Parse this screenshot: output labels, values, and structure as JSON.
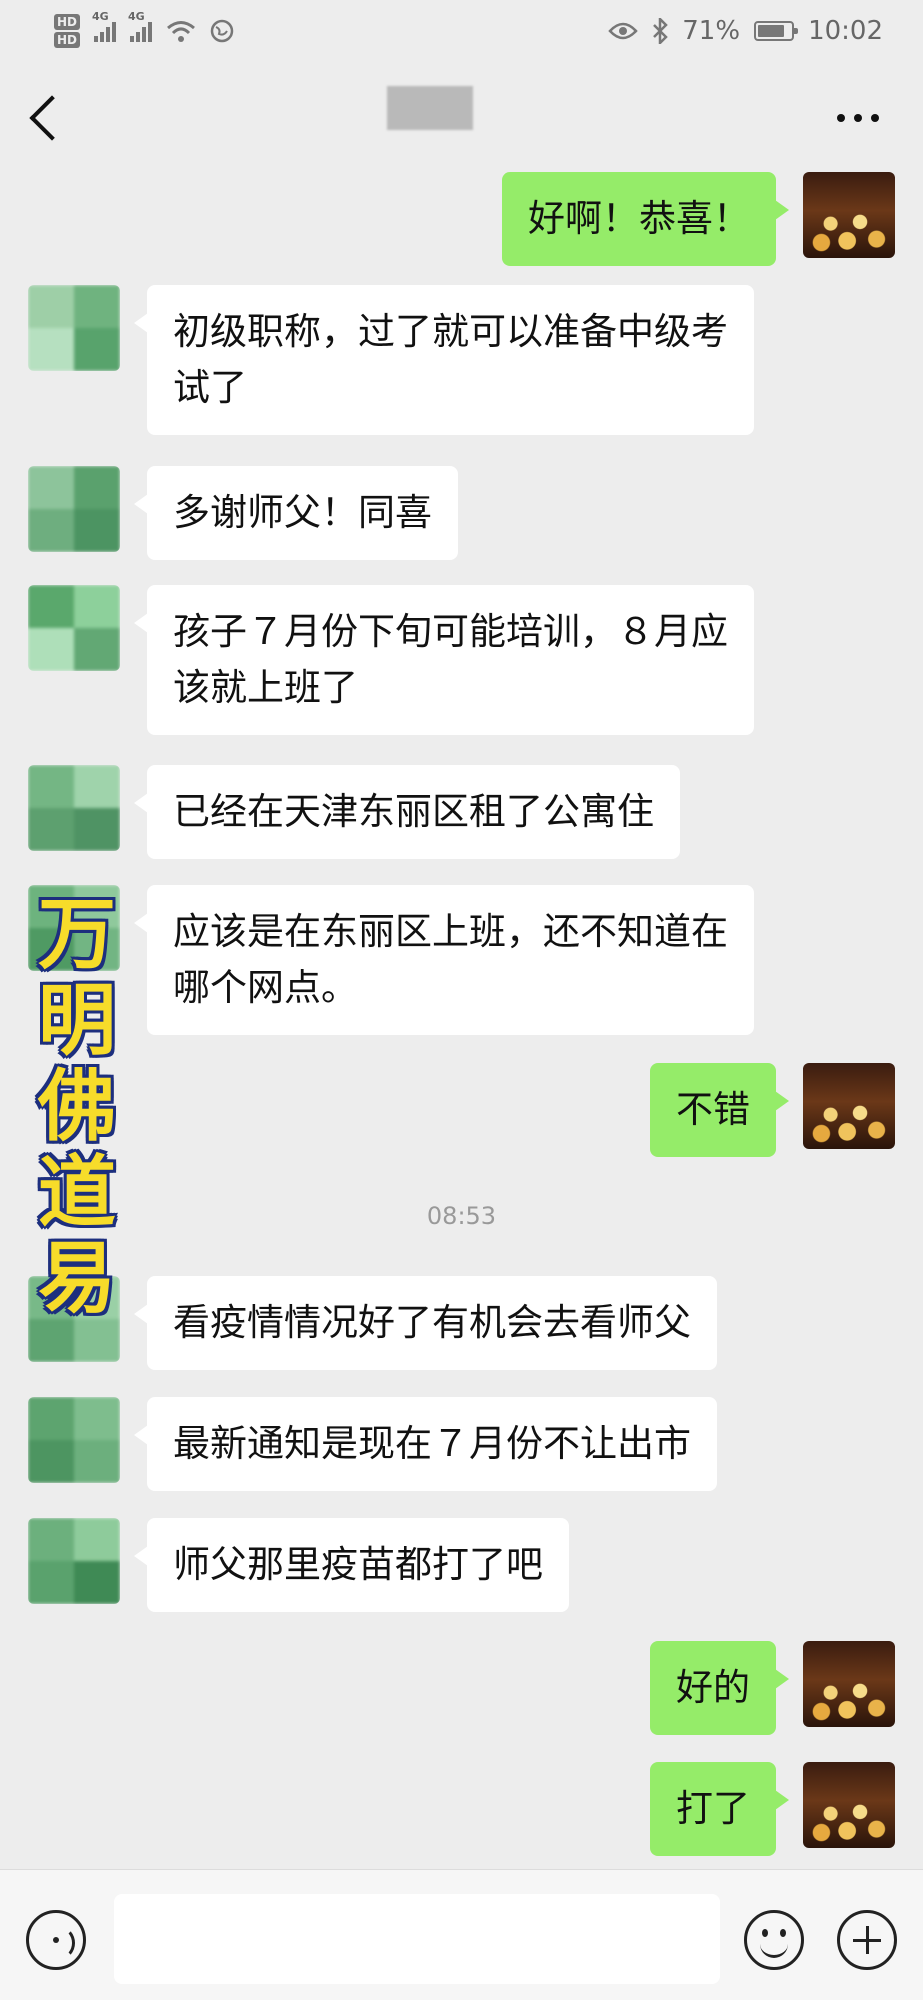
{
  "status_bar": {
    "hd_labels": [
      "HD",
      "HD"
    ],
    "signal_labels": [
      "4G",
      "4G"
    ],
    "battery": "71%",
    "time": "10:02",
    "icons": [
      "eye-icon",
      "bluetooth-icon",
      "wifi-icon",
      "battery-icon"
    ]
  },
  "header": {
    "title": "",
    "back_icon": "back-arrow-icon",
    "more_icon": "more-icon"
  },
  "messages": [
    {
      "side": "right",
      "text": "好啊！恭喜！"
    },
    {
      "side": "left",
      "text": "初级职称，过了就可以准备中级考\n试了"
    },
    {
      "side": "left",
      "text": "多谢师父！同喜"
    },
    {
      "side": "left",
      "text": "孩子７月份下旬可能培训，８月应\n该就上班了"
    },
    {
      "side": "left",
      "text": "已经在天津东丽区租了公寓住"
    },
    {
      "side": "left",
      "text": "应该是在东丽区上班，还不知道在\n哪个网点。"
    },
    {
      "side": "right",
      "text": "不错"
    },
    {
      "side": "time",
      "text": "08:53"
    },
    {
      "side": "left",
      "text": "看疫情情况好了有机会去看师父"
    },
    {
      "side": "left",
      "text": "最新通知是现在７月份不让出市"
    },
    {
      "side": "left",
      "text": "师父那里疫苗都打了吧"
    },
    {
      "side": "right",
      "text": "好的"
    },
    {
      "side": "right",
      "text": "打了"
    }
  ],
  "watermark": [
    "万",
    "明",
    "佛",
    "道",
    "易"
  ],
  "input_bar": {
    "voice_icon": "voice-icon",
    "input_placeholder": "",
    "emoji_icon": "emoji-icon",
    "plus_icon": "plus-icon"
  },
  "colors": {
    "background": "#ededed",
    "bubble_self": "#95ec69",
    "bubble_other": "#ffffff",
    "watermark_fill": "#f7dc2a",
    "watermark_outline": "#1d2f7e"
  }
}
